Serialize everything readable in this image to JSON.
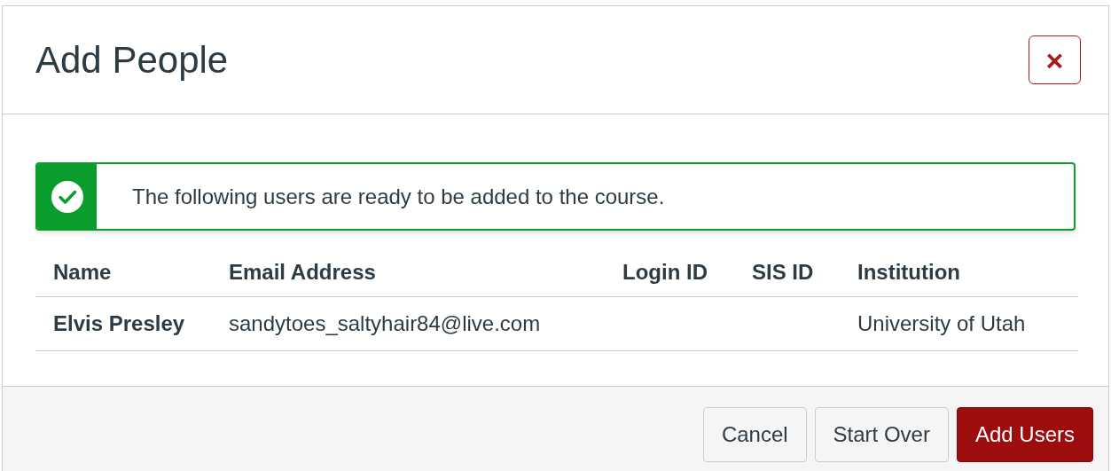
{
  "dialog": {
    "title": "Add People",
    "close_label": "×"
  },
  "alert": {
    "message": "The following users are ready to be added to the course."
  },
  "table": {
    "columns": [
      "Name",
      "Email Address",
      "Login ID",
      "SIS ID",
      "Institution"
    ],
    "rows": [
      {
        "cells": [
          "Elvis Presley",
          "sandytoes_saltyhair84@live.com",
          null,
          null,
          "University of Utah"
        ]
      }
    ]
  },
  "buttons": [
    {
      "label": "Cancel",
      "kind": "secondary"
    },
    {
      "label": "Start Over",
      "kind": "secondary"
    },
    {
      "label": "Add Users",
      "kind": "primary"
    }
  ]
}
